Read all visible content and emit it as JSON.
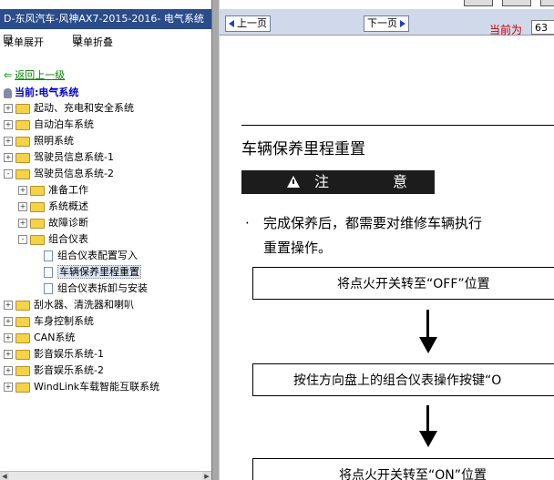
{
  "left": {
    "title": "D-东风汽车-风神AX7-2015-2016- 电气系统",
    "menu_expand": "菜单展开",
    "menu_collapse": "菜单折叠",
    "back": "返回上一级",
    "current": "当前:电气系统",
    "tree": [
      {
        "label": "起动、充电和安全系统",
        "level": 0,
        "kind": "folder",
        "exp": "+"
      },
      {
        "label": "自动泊车系统",
        "level": 0,
        "kind": "folder",
        "exp": "+"
      },
      {
        "label": "照明系统",
        "level": 0,
        "kind": "folder",
        "exp": "+"
      },
      {
        "label": "驾驶员信息系统-1",
        "level": 0,
        "kind": "folder",
        "exp": "+"
      },
      {
        "label": "驾驶员信息系统-2",
        "level": 0,
        "kind": "folder",
        "exp": "-"
      },
      {
        "label": "准备工作",
        "level": 1,
        "kind": "folder",
        "exp": "+"
      },
      {
        "label": "系统概述",
        "level": 1,
        "kind": "folder",
        "exp": "+"
      },
      {
        "label": "故障诊断",
        "level": 1,
        "kind": "folder",
        "exp": "+"
      },
      {
        "label": "组合仪表",
        "level": 1,
        "kind": "folder",
        "exp": "-"
      },
      {
        "label": "组合仪表配置写入",
        "level": 2,
        "kind": "doc",
        "exp": ""
      },
      {
        "label": "车辆保养里程重置",
        "level": 2,
        "kind": "doc",
        "exp": "",
        "selected": true
      },
      {
        "label": "组合仪表拆卸与安装",
        "level": 2,
        "kind": "doc",
        "exp": ""
      },
      {
        "label": "刮水器、清洗器和喇叭",
        "level": 0,
        "kind": "folder",
        "exp": "+"
      },
      {
        "label": "车身控制系统",
        "level": 0,
        "kind": "folder",
        "exp": "+"
      },
      {
        "label": "CAN系统",
        "level": 0,
        "kind": "folder",
        "exp": "+"
      },
      {
        "label": "影音娱乐系统-1",
        "level": 0,
        "kind": "folder",
        "exp": "+"
      },
      {
        "label": "影音娱乐系统-2",
        "level": 0,
        "kind": "folder",
        "exp": "+"
      },
      {
        "label": "WindLink车载智能互联系统",
        "level": 0,
        "kind": "folder",
        "exp": "+"
      }
    ]
  },
  "toolbar": {
    "prev": "上一页",
    "next": "下一页",
    "page_label": "当前为",
    "page_value": "63"
  },
  "doc": {
    "heading": "车辆保养里程重置",
    "notice_a": "注",
    "notice_b": "意",
    "bullet": "·",
    "para_line1": "完成保养后，都需要对维修车辆执行",
    "para_line2": "重置操作。",
    "step1": "将点火开关转至“OFF”位置",
    "step2": "按住方向盘上的组合仪表操作按键“O",
    "step3": "将点火开关转至“ON”位置"
  }
}
